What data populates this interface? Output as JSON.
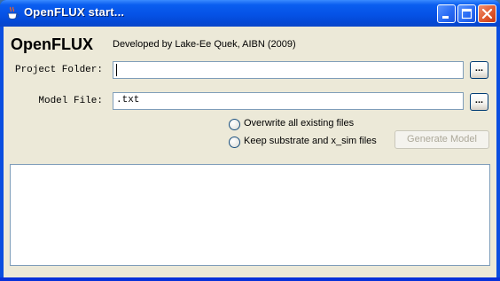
{
  "window": {
    "title": "OpenFLUX start...",
    "icon": "java-cup-icon",
    "controls": [
      "minimize-icon",
      "maximize-icon",
      "close-icon"
    ]
  },
  "header": {
    "app_name": "OpenFLUX",
    "credit": "Developed by Lake-Ee Quek, AIBN (2009)"
  },
  "project_folder": {
    "label": "Project Folder:",
    "value": "",
    "browse_label": "..."
  },
  "model_file": {
    "label": "Model File:",
    "value": ".txt",
    "browse_label": "..."
  },
  "options": [
    {
      "label": "Overwrite all existing files",
      "selected": false
    },
    {
      "label": "Keep substrate and x_sim files",
      "selected": false
    }
  ],
  "generate_button": {
    "label": "Generate Model",
    "enabled": false
  },
  "log": {
    "text": ""
  }
}
